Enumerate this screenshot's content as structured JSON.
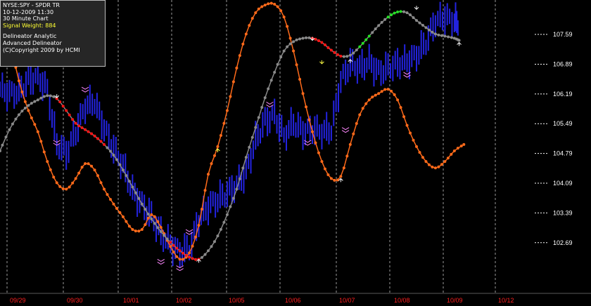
{
  "info_box": {
    "symbol": "NYSE:SPY - SPDR TR",
    "datetime": "10-12-2009  11:30",
    "interval": "30 Minute Chart",
    "signal_weight": "Signal Weight: 884",
    "line1": "Delineator Analytic",
    "line2": "Advanced Delineator",
    "copyright": "(C)Copyright 2009 by HCMI"
  },
  "colors": {
    "background": "#000000",
    "price_bars": "#2323e0",
    "orange_line": "#ff6a1a",
    "gray_line": "#8a8a8a",
    "red_segment": "#ff1414",
    "green_segment": "#22e022",
    "signal_weight_text": "#ffff33",
    "date_labels": "#ff2020",
    "price_labels": "#ffffff",
    "grid": "#9a9a9a"
  },
  "chart_data": {
    "type": "line",
    "title": "",
    "xlabel": "",
    "ylabel": "",
    "x_tick_labels": [
      "09/29",
      "09/30",
      "10/01",
      "10/02",
      "10/05",
      "10/06",
      "10/07",
      "10/08",
      "10/09",
      "10/12"
    ],
    "y_tick_labels": [
      "107.59",
      "106.89",
      "106.19",
      "105.49",
      "104.79",
      "104.09",
      "103.39",
      "102.69"
    ],
    "y_ticks": [
      107.59,
      106.89,
      106.19,
      105.49,
      104.79,
      104.09,
      103.39,
      102.69
    ],
    "ylim": [
      101.63,
      108.4
    ],
    "grid": true,
    "legend": "none",
    "x_range": [
      0,
      110
    ],
    "series": [
      {
        "role": "orange_oscillator",
        "values": [
          [
            0,
            108.4
          ],
          [
            2,
            107.5
          ],
          [
            4,
            106.5
          ],
          [
            6,
            105.8
          ],
          [
            8,
            105.3
          ],
          [
            10,
            104.6
          ],
          [
            12,
            104.1
          ],
          [
            14,
            103.95
          ],
          [
            16,
            104.2
          ],
          [
            18,
            104.55
          ],
          [
            20,
            104.4
          ],
          [
            22,
            103.95
          ],
          [
            24,
            103.6
          ],
          [
            26,
            103.3
          ],
          [
            28,
            103.0
          ],
          [
            30,
            103.0
          ],
          [
            32,
            103.35
          ],
          [
            34,
            103.05
          ],
          [
            36,
            102.6
          ],
          [
            38,
            102.3
          ],
          [
            40,
            102.45
          ],
          [
            42,
            103.1
          ],
          [
            44,
            104.3
          ],
          [
            46,
            104.95
          ],
          [
            48,
            105.8
          ],
          [
            50,
            106.8
          ],
          [
            52,
            107.6
          ],
          [
            54,
            108.1
          ],
          [
            56,
            108.28
          ],
          [
            58,
            108.3
          ],
          [
            60,
            108.0
          ],
          [
            62,
            107.2
          ],
          [
            64,
            106.2
          ],
          [
            66,
            105.3
          ],
          [
            68,
            104.6
          ],
          [
            70,
            104.2
          ],
          [
            72,
            104.25
          ],
          [
            74,
            105.0
          ],
          [
            76,
            105.7
          ],
          [
            78,
            106.05
          ],
          [
            80,
            106.2
          ],
          [
            82,
            106.3
          ],
          [
            84,
            106.05
          ],
          [
            86,
            105.45
          ],
          [
            88,
            104.95
          ],
          [
            90,
            104.6
          ],
          [
            92,
            104.45
          ],
          [
            94,
            104.6
          ],
          [
            96,
            104.85
          ],
          [
            98,
            105.0
          ]
        ]
      },
      {
        "role": "gray_trend",
        "values": [
          [
            0,
            104.85
          ],
          [
            2,
            105.35
          ],
          [
            4,
            105.7
          ],
          [
            6,
            105.92
          ],
          [
            8,
            106.05
          ],
          [
            10,
            106.15
          ],
          [
            12,
            106.08
          ],
          [
            14,
            105.8
          ],
          [
            16,
            105.5
          ],
          [
            18,
            105.35
          ],
          [
            20,
            105.2
          ],
          [
            22,
            105.0
          ],
          [
            24,
            104.75
          ],
          [
            26,
            104.4
          ],
          [
            28,
            104.0
          ],
          [
            30,
            103.6
          ],
          [
            32,
            103.25
          ],
          [
            34,
            102.95
          ],
          [
            36,
            102.7
          ],
          [
            38,
            102.5
          ],
          [
            40,
            102.35
          ],
          [
            42,
            102.3
          ],
          [
            44,
            102.5
          ],
          [
            46,
            102.85
          ],
          [
            48,
            103.35
          ],
          [
            50,
            103.95
          ],
          [
            52,
            104.7
          ],
          [
            54,
            105.4
          ],
          [
            56,
            106.1
          ],
          [
            58,
            106.7
          ],
          [
            60,
            107.2
          ],
          [
            62,
            107.42
          ],
          [
            64,
            107.5
          ],
          [
            66,
            107.5
          ],
          [
            68,
            107.4
          ],
          [
            70,
            107.22
          ],
          [
            72,
            107.08
          ],
          [
            74,
            107.1
          ],
          [
            76,
            107.3
          ],
          [
            78,
            107.55
          ],
          [
            80,
            107.8
          ],
          [
            82,
            108.0
          ],
          [
            84,
            108.12
          ],
          [
            86,
            108.1
          ],
          [
            88,
            107.92
          ],
          [
            90,
            107.75
          ],
          [
            92,
            107.6
          ],
          [
            94,
            107.55
          ],
          [
            96,
            107.5
          ],
          [
            97,
            107.45
          ]
        ],
        "red_ranges": [
          [
            12,
            22
          ],
          [
            36,
            42
          ],
          [
            66,
            72
          ]
        ],
        "green_ranges": [
          [
            76,
            78
          ],
          [
            82,
            85
          ]
        ]
      },
      {
        "role": "price_bars",
        "values": [
          [
            0,
            106.3
          ],
          [
            2,
            106.2
          ],
          [
            4,
            106.25
          ],
          [
            6,
            106.5
          ],
          [
            8,
            106.6
          ],
          [
            10,
            106.3
          ],
          [
            12,
            105.0
          ],
          [
            14,
            104.8
          ],
          [
            16,
            105.3
          ],
          [
            18,
            105.9
          ],
          [
            20,
            106.0
          ],
          [
            22,
            105.4
          ],
          [
            24,
            104.9
          ],
          [
            26,
            104.5
          ],
          [
            28,
            103.9
          ],
          [
            30,
            103.6
          ],
          [
            32,
            103.3
          ],
          [
            34,
            102.9
          ],
          [
            36,
            102.65
          ],
          [
            38,
            102.45
          ],
          [
            40,
            102.55
          ],
          [
            42,
            103.2
          ],
          [
            44,
            103.55
          ],
          [
            46,
            103.7
          ],
          [
            48,
            103.85
          ],
          [
            50,
            104.05
          ],
          [
            52,
            104.35
          ],
          [
            54,
            105.1
          ],
          [
            56,
            105.55
          ],
          [
            58,
            105.7
          ],
          [
            60,
            105.2
          ],
          [
            62,
            105.5
          ],
          [
            64,
            105.3
          ],
          [
            66,
            105.35
          ],
          [
            68,
            105.3
          ],
          [
            70,
            105.35
          ],
          [
            72,
            106.5
          ],
          [
            74,
            106.9
          ],
          [
            76,
            106.8
          ],
          [
            78,
            106.95
          ],
          [
            80,
            106.7
          ],
          [
            82,
            106.8
          ],
          [
            84,
            106.9
          ],
          [
            86,
            106.95
          ],
          [
            88,
            107.1
          ],
          [
            90,
            107.4
          ],
          [
            92,
            107.9
          ],
          [
            94,
            108.0
          ],
          [
            96,
            107.9
          ],
          [
            97,
            107.85
          ]
        ]
      }
    ]
  }
}
